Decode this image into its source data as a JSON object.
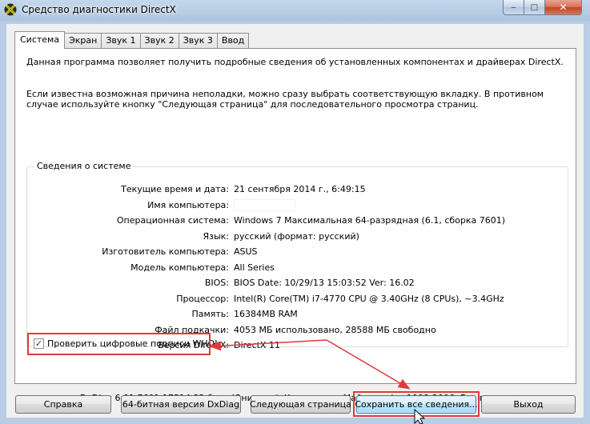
{
  "window": {
    "title": "Средство диагностики DirectX",
    "icon": "directx-icon",
    "minimize_glyph": "‒",
    "maximize_glyph": "□",
    "close_glyph": "✕"
  },
  "tabs": [
    {
      "label": "Система",
      "active": true
    },
    {
      "label": "Экран",
      "active": false
    },
    {
      "label": "Звук 1",
      "active": false
    },
    {
      "label": "Звук 2",
      "active": false
    },
    {
      "label": "Звук 3",
      "active": false
    },
    {
      "label": "Ввод",
      "active": false
    }
  ],
  "intro": {
    "line1": "Данная программа позволяет получить подробные сведения об установленных компонентах и драйверах DirectX.",
    "line2": "Если известна возможная причина неполадки, можно сразу выбрать соответствующую вкладку. В противном случае используйте кнопку \"Следующая страница\" для последовательного просмотра страниц."
  },
  "system_info": {
    "group_title": "Сведения о системе",
    "rows": [
      {
        "label": "Текущие время и дата:",
        "value": "21 сентября 2014 г., 6:49:15"
      },
      {
        "label": "Имя компьютера:",
        "value": ""
      },
      {
        "label": "Операционная система:",
        "value": "Windows 7 Максимальная 64-разрядная (6.1, сборка 7601)"
      },
      {
        "label": "Язык:",
        "value": "русский (формат: русский)"
      },
      {
        "label": "Изготовитель компьютера:",
        "value": "ASUS"
      },
      {
        "label": "Модель компьютера:",
        "value": "All Series"
      },
      {
        "label": "BIOS:",
        "value": "BIOS Date: 10/29/13 15:03:52 Ver: 16.02"
      },
      {
        "label": "Процессор:",
        "value": "Intel(R) Core(TM) i7-4770 CPU @ 3.40GHz (8 CPUs), ~3.4GHz"
      },
      {
        "label": "Память:",
        "value": "16384MB RAM"
      },
      {
        "label": "Файл подкачки:",
        "value": "4053 МБ использовано, 28588 МБ свободно"
      },
      {
        "label": "Версия DirectX:",
        "value": "DirectX 11"
      }
    ]
  },
  "whql": {
    "label": "Проверить цифровые подписи WHQL",
    "checked": true,
    "check_glyph": "✓"
  },
  "copyright": "DxDiag 6.01.7601.17514 32 бита Юникод  © Корпорация Майкрософт, 1998-2006.  Все права защищены.",
  "buttons": {
    "help": "Справка",
    "dxdiag64": "64-битная версия DxDiag",
    "next_page": "Следующая страница",
    "save_all": "Сохранить все сведения...",
    "exit": "Выход"
  },
  "colors": {
    "annotation_red": "#e0393b",
    "window_frame": "#b9cde4",
    "focus_blue": "#3c7fb1"
  }
}
